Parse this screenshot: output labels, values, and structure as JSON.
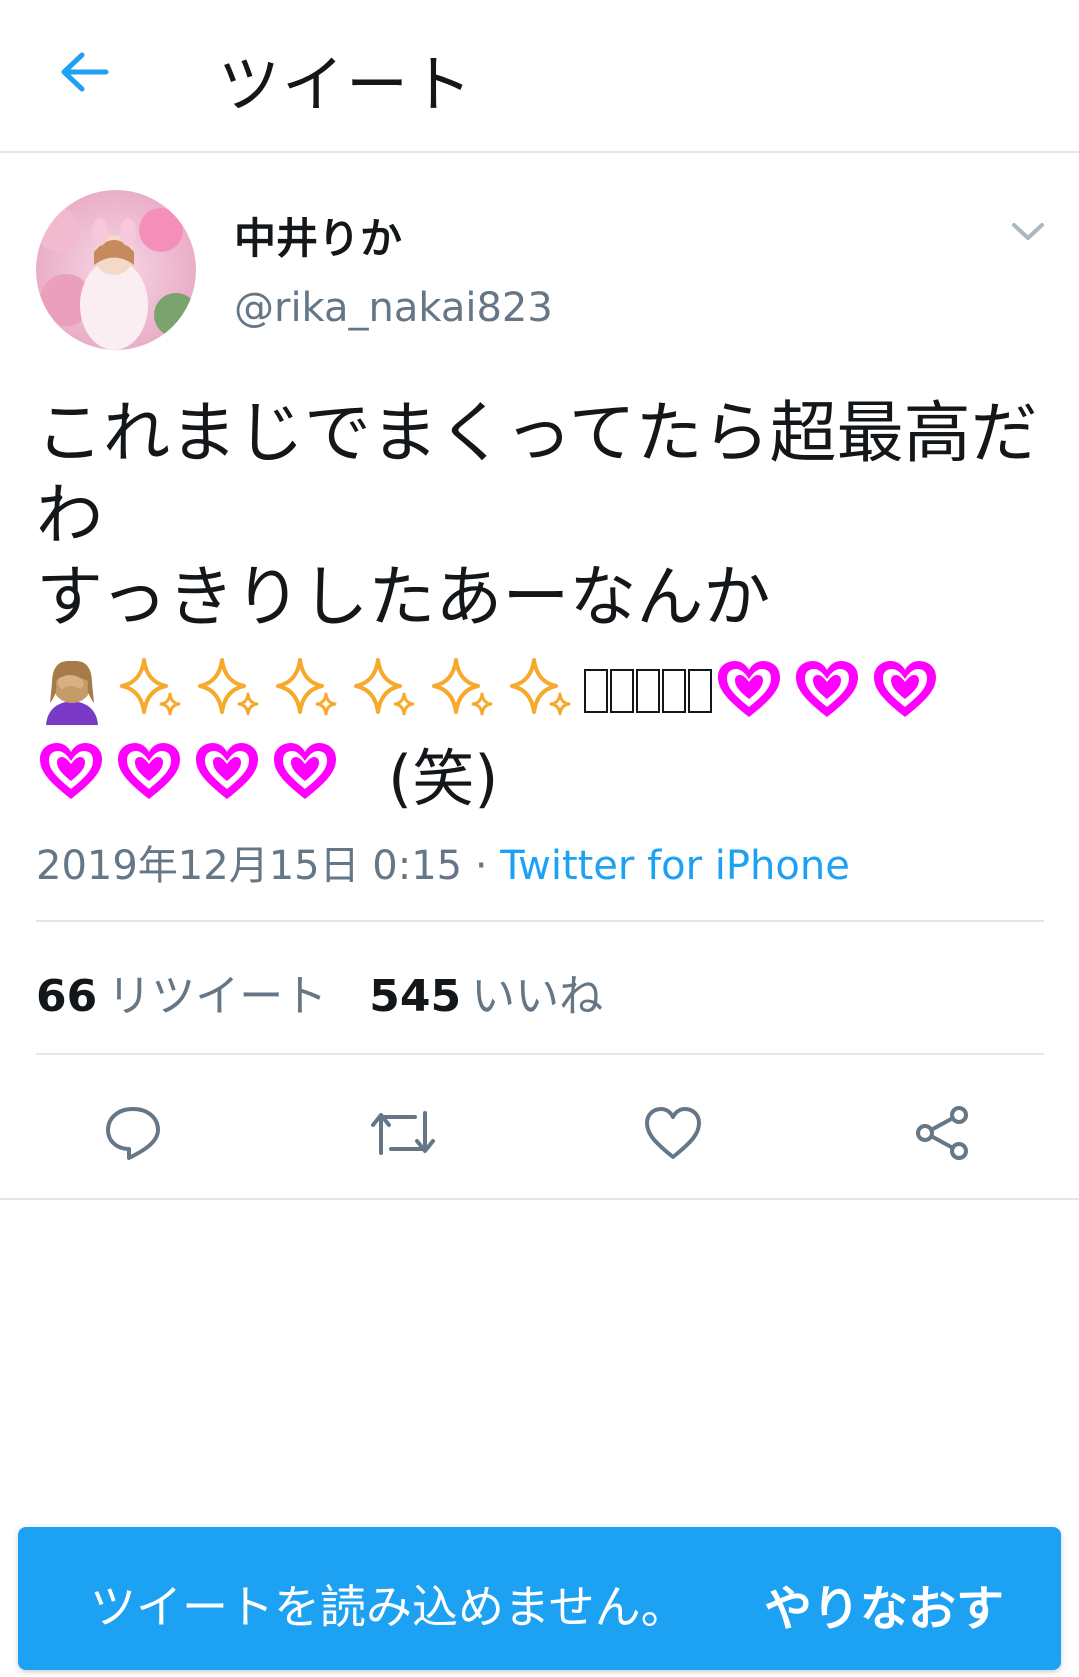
{
  "header": {
    "title": "ツイート",
    "back_icon": "arrow-left-icon"
  },
  "user": {
    "display_name": "中井りか",
    "handle": "@rika_nakai823"
  },
  "tweet": {
    "lines": [
      "これまじでまくってたら超最高だ",
      "わ",
      "すっきりしたあーなんか"
    ],
    "laugh": "(笑)",
    "emoji": {
      "facepalm": "facepalm-emoji",
      "sparkles_count": 6,
      "missing_glyphs_count": 5,
      "hearts_row1_count": 3,
      "hearts_row2_count": 4
    },
    "timestamp": "2019年12月15日 0:15",
    "separator": " · ",
    "source": "Twitter for iPhone"
  },
  "stats": {
    "retweets_count": "66",
    "retweets_label": "リツイート",
    "likes_count": "545",
    "likes_label": "いいね"
  },
  "actions": [
    "reply-icon",
    "retweet-icon",
    "like-icon",
    "share-icon"
  ],
  "toast": {
    "message": "ツイートを読み込めません。",
    "retry": "やりなおす"
  },
  "colors": {
    "accent": "#1da1f2",
    "muted": "#657786",
    "text": "#14171a",
    "divider": "#e1e8ed",
    "heart": "#ff00ff",
    "sparkle": "#f7a92c"
  }
}
